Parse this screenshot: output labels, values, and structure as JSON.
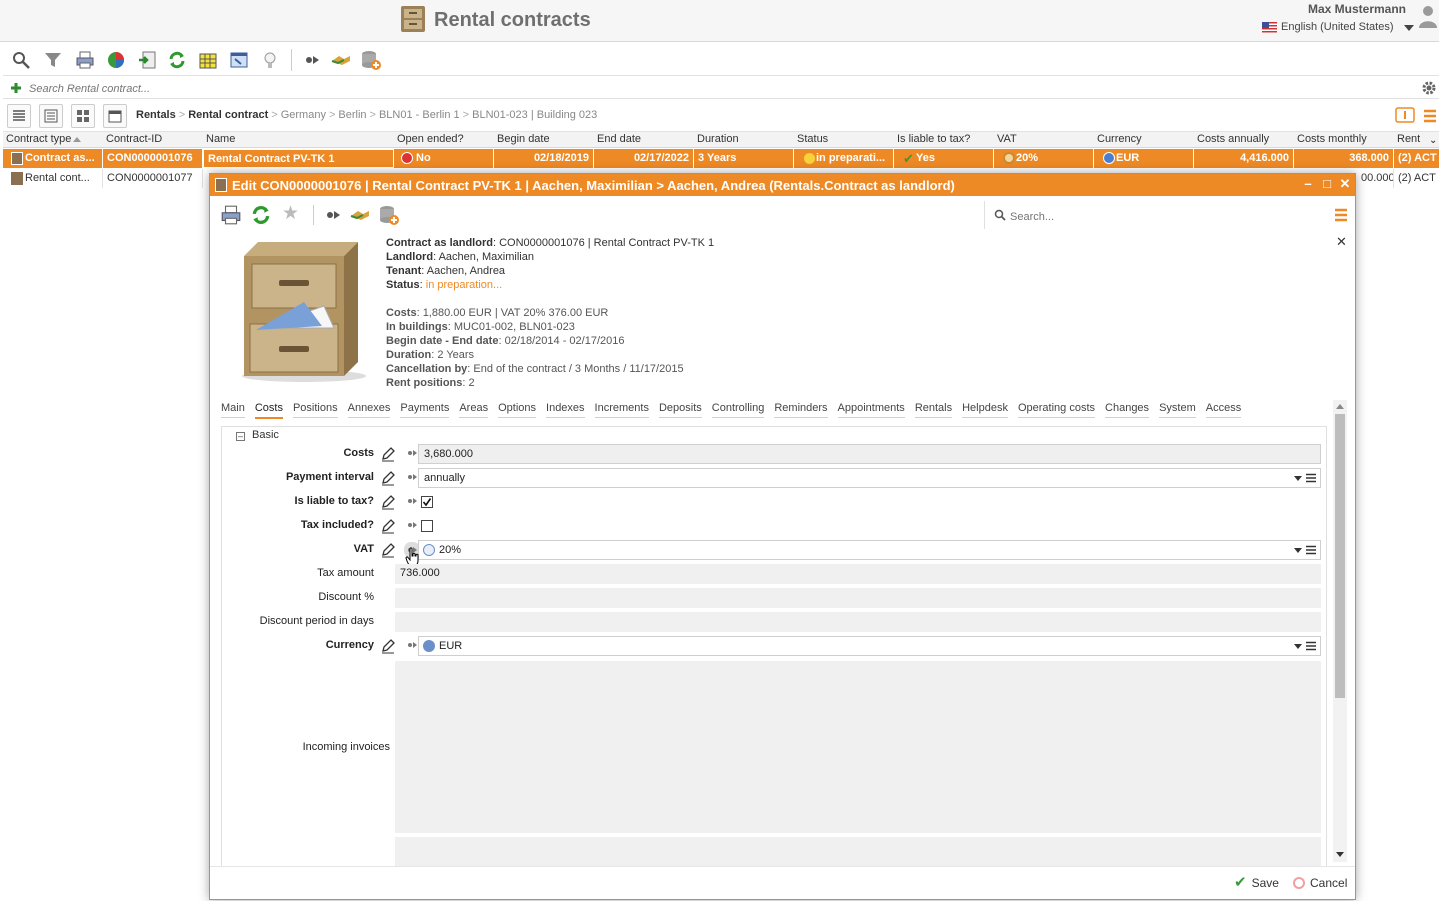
{
  "header": {
    "title": "Rental contracts",
    "user_name": "Max Mustermann",
    "language": "English (United States)"
  },
  "toolbar": {
    "icons": [
      "search-icon",
      "filter-icon",
      "print-icon",
      "chart-icon",
      "export-icon",
      "refresh-icon",
      "grid-select-icon",
      "window-icon",
      "lightbulb-icon",
      "forward-icon",
      "handshake-icon",
      "database-add-icon"
    ]
  },
  "search": {
    "placeholder": "Search Rental contract..."
  },
  "breadcrumb": {
    "items": [
      "Rentals",
      "Rental contract",
      "Germany",
      "Berlin",
      "BLN01 - Berlin 1",
      "BLN01-023 | Building 023"
    ]
  },
  "grid": {
    "columns": [
      "Contract type",
      "Contract-ID",
      "Name",
      "Open ended?",
      "Begin date",
      "End date",
      "Duration",
      "Status",
      "Is liable to tax?",
      "VAT",
      "Currency",
      "Costs annually",
      "Costs monthly",
      "Rent"
    ],
    "rows": [
      {
        "type": "Contract as...",
        "id": "CON0000001076",
        "name": "Rental Contract PV-TK 1",
        "open_ended": "No",
        "begin": "02/18/2019",
        "end": "02/17/2022",
        "duration": "3 Years",
        "status": "in preparati...",
        "taxable": "Yes",
        "vat": "20%",
        "currency": "EUR",
        "costs_annually": "4,416.000",
        "costs_monthly": "368.000",
        "rent": "(2) ACT"
      },
      {
        "type": "Rental cont...",
        "id": "CON0000001077",
        "costs_monthly": "00.000",
        "rent": "(2) ACT"
      }
    ]
  },
  "dialog": {
    "title": "Edit CON0000001076 | Rental Contract PV-TK 1 | Aachen, Maximilian > Aachen, Andrea (Rentals.Contract as landlord)",
    "search_placeholder": "Search...",
    "summary": {
      "contract_label": "Contract as landlord",
      "contract_value": "CON0000001076 | Rental Contract PV-TK 1",
      "landlord_label": "Landlord",
      "landlord_value": "Aachen, Maximilian",
      "tenant_label": "Tenant",
      "tenant_value": "Aachen, Andrea",
      "status_label": "Status",
      "status_value": "in preparation...",
      "costs_label": "Costs",
      "costs_value": "1,880.00 EUR | VAT 20% 376.00 EUR",
      "buildings_label": "In buildings",
      "buildings_value": "MUC01-002, BLN01-023",
      "dates_label": "Begin date - End date",
      "dates_value": "02/18/2014 - 02/17/2016",
      "duration_label": "Duration",
      "duration_value": "2 Years",
      "cancel_label": "Cancellation by",
      "cancel_value": "End of the contract / 3 Months / 11/17/2015",
      "positions_label": "Rent positions",
      "positions_value": "2"
    },
    "tabs": [
      "Main",
      "Costs",
      "Positions",
      "Annexes",
      "Payments",
      "Areas",
      "Options",
      "Indexes",
      "Increments",
      "Deposits",
      "Controlling",
      "Reminders",
      "Appointments",
      "Rentals",
      "Helpdesk",
      "Operating costs",
      "Changes",
      "System",
      "Access"
    ],
    "active_tab": "Costs",
    "section": "Basic",
    "form": {
      "costs_label": "Costs",
      "costs_value": "3,680.000",
      "interval_label": "Payment interval",
      "interval_value": "annually",
      "taxable_label": "Is liable to tax?",
      "tax_included_label": "Tax included?",
      "vat_label": "VAT",
      "vat_value": "20%",
      "tax_amount_label": "Tax amount",
      "tax_amount_value": "736.000",
      "discount_label": "Discount %",
      "discount_days_label": "Discount period in days",
      "currency_label": "Currency",
      "currency_value": "EUR",
      "invoices_label": "Incoming invoices"
    },
    "save_label": "Save",
    "cancel_label": "Cancel"
  },
  "colors": {
    "accent": "#ee8a25",
    "header_text": "#6f6f6f"
  }
}
